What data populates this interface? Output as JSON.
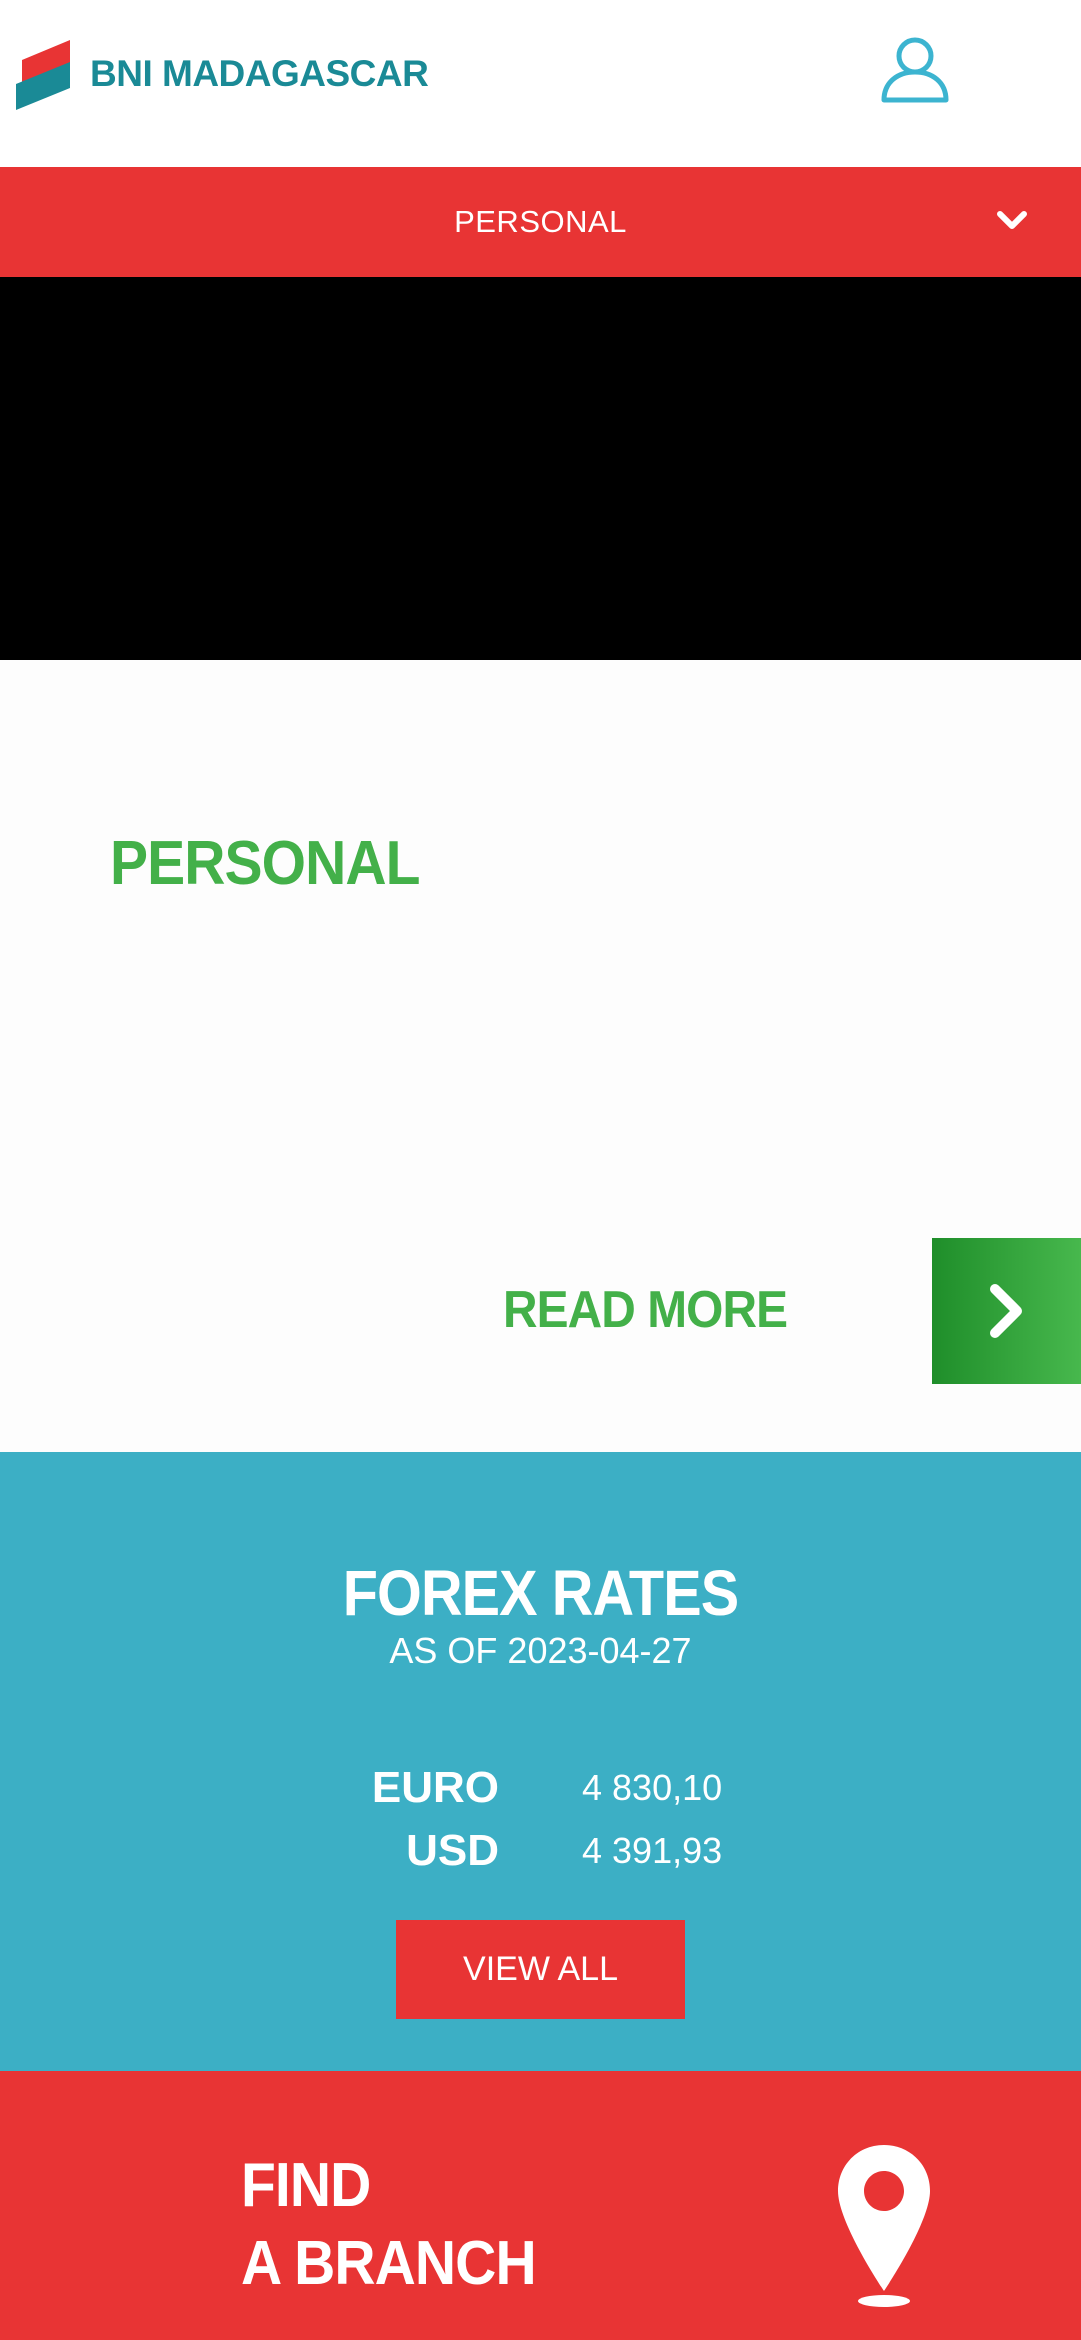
{
  "header": {
    "logo_text": "BNI MADAGASCAR",
    "icons": {
      "logo": "bni-logo-mark",
      "account": "user-icon"
    }
  },
  "nav": {
    "selected": "PERSONAL",
    "icon": "chevron-down-icon"
  },
  "personal": {
    "title": "PERSONAL",
    "read_more_label": "READ MORE",
    "arrow_icon": "chevron-right-icon"
  },
  "forex": {
    "title": "FOREX RATES",
    "date_label": "AS OF 2023-04-27",
    "rates": [
      {
        "currency": "EURO",
        "value": "4 830,10"
      },
      {
        "currency": "USD",
        "value": "4 391,93"
      }
    ],
    "view_all_label": "VIEW ALL"
  },
  "find_branch": {
    "line1": "FIND",
    "line2": "A BRANCH",
    "icon": "location-pin-icon"
  },
  "colors": {
    "brand_red": "#e83434",
    "brand_teal": "#1a8a96",
    "forex_blue": "#3cafc5",
    "accent_green": "#43b049",
    "user_icon_blue": "#3cb4d0"
  }
}
